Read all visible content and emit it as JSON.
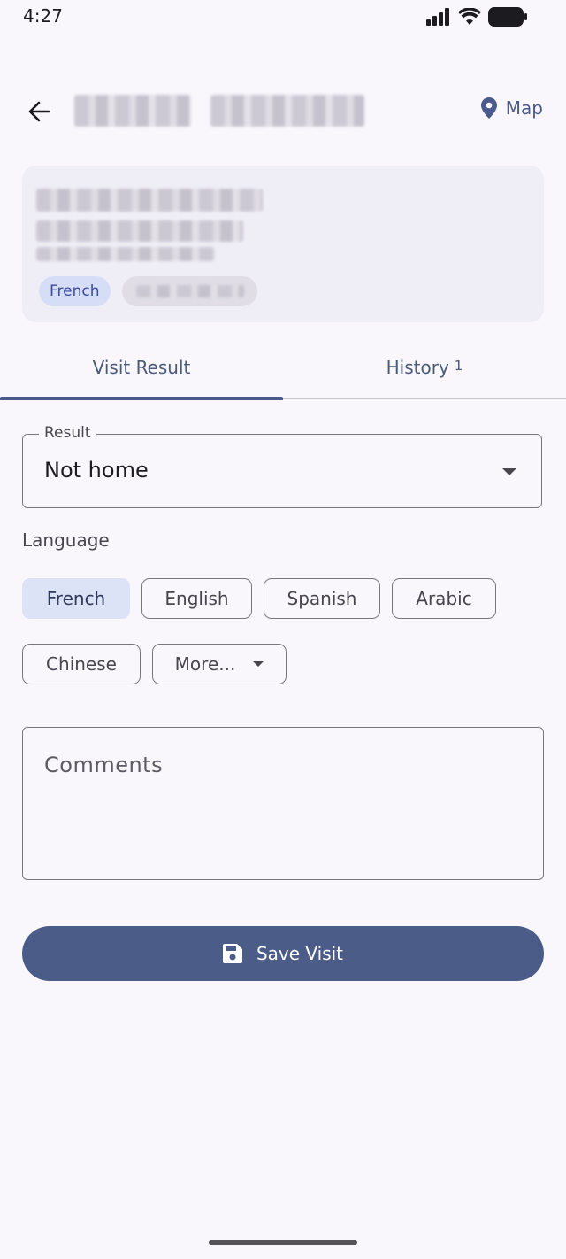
{
  "status_bar": {
    "time": "4:27",
    "icons": [
      "signal-icon",
      "wifi-icon",
      "battery-icon"
    ]
  },
  "app_bar": {
    "back_icon": "arrow-left-icon",
    "map_label": "Map",
    "map_icon": "location-pin-icon"
  },
  "card": {
    "language_tag": "French"
  },
  "tabs": [
    {
      "label": "Visit Result",
      "active": true
    },
    {
      "label": "History",
      "badge": "1",
      "active": false
    }
  ],
  "result_field": {
    "label": "Result",
    "value": "Not home"
  },
  "language": {
    "label": "Language",
    "options": [
      "French",
      "English",
      "Spanish",
      "Arabic",
      "Chinese",
      "More..."
    ],
    "selected": "French"
  },
  "comments": {
    "placeholder": "Comments"
  },
  "save_button": {
    "label": "Save Visit",
    "icon": "save-icon"
  },
  "colors": {
    "primary": "#4c5c89",
    "background": "#f9f7fc",
    "card": "#efeef6",
    "selected_chip": "#dde3f6"
  }
}
